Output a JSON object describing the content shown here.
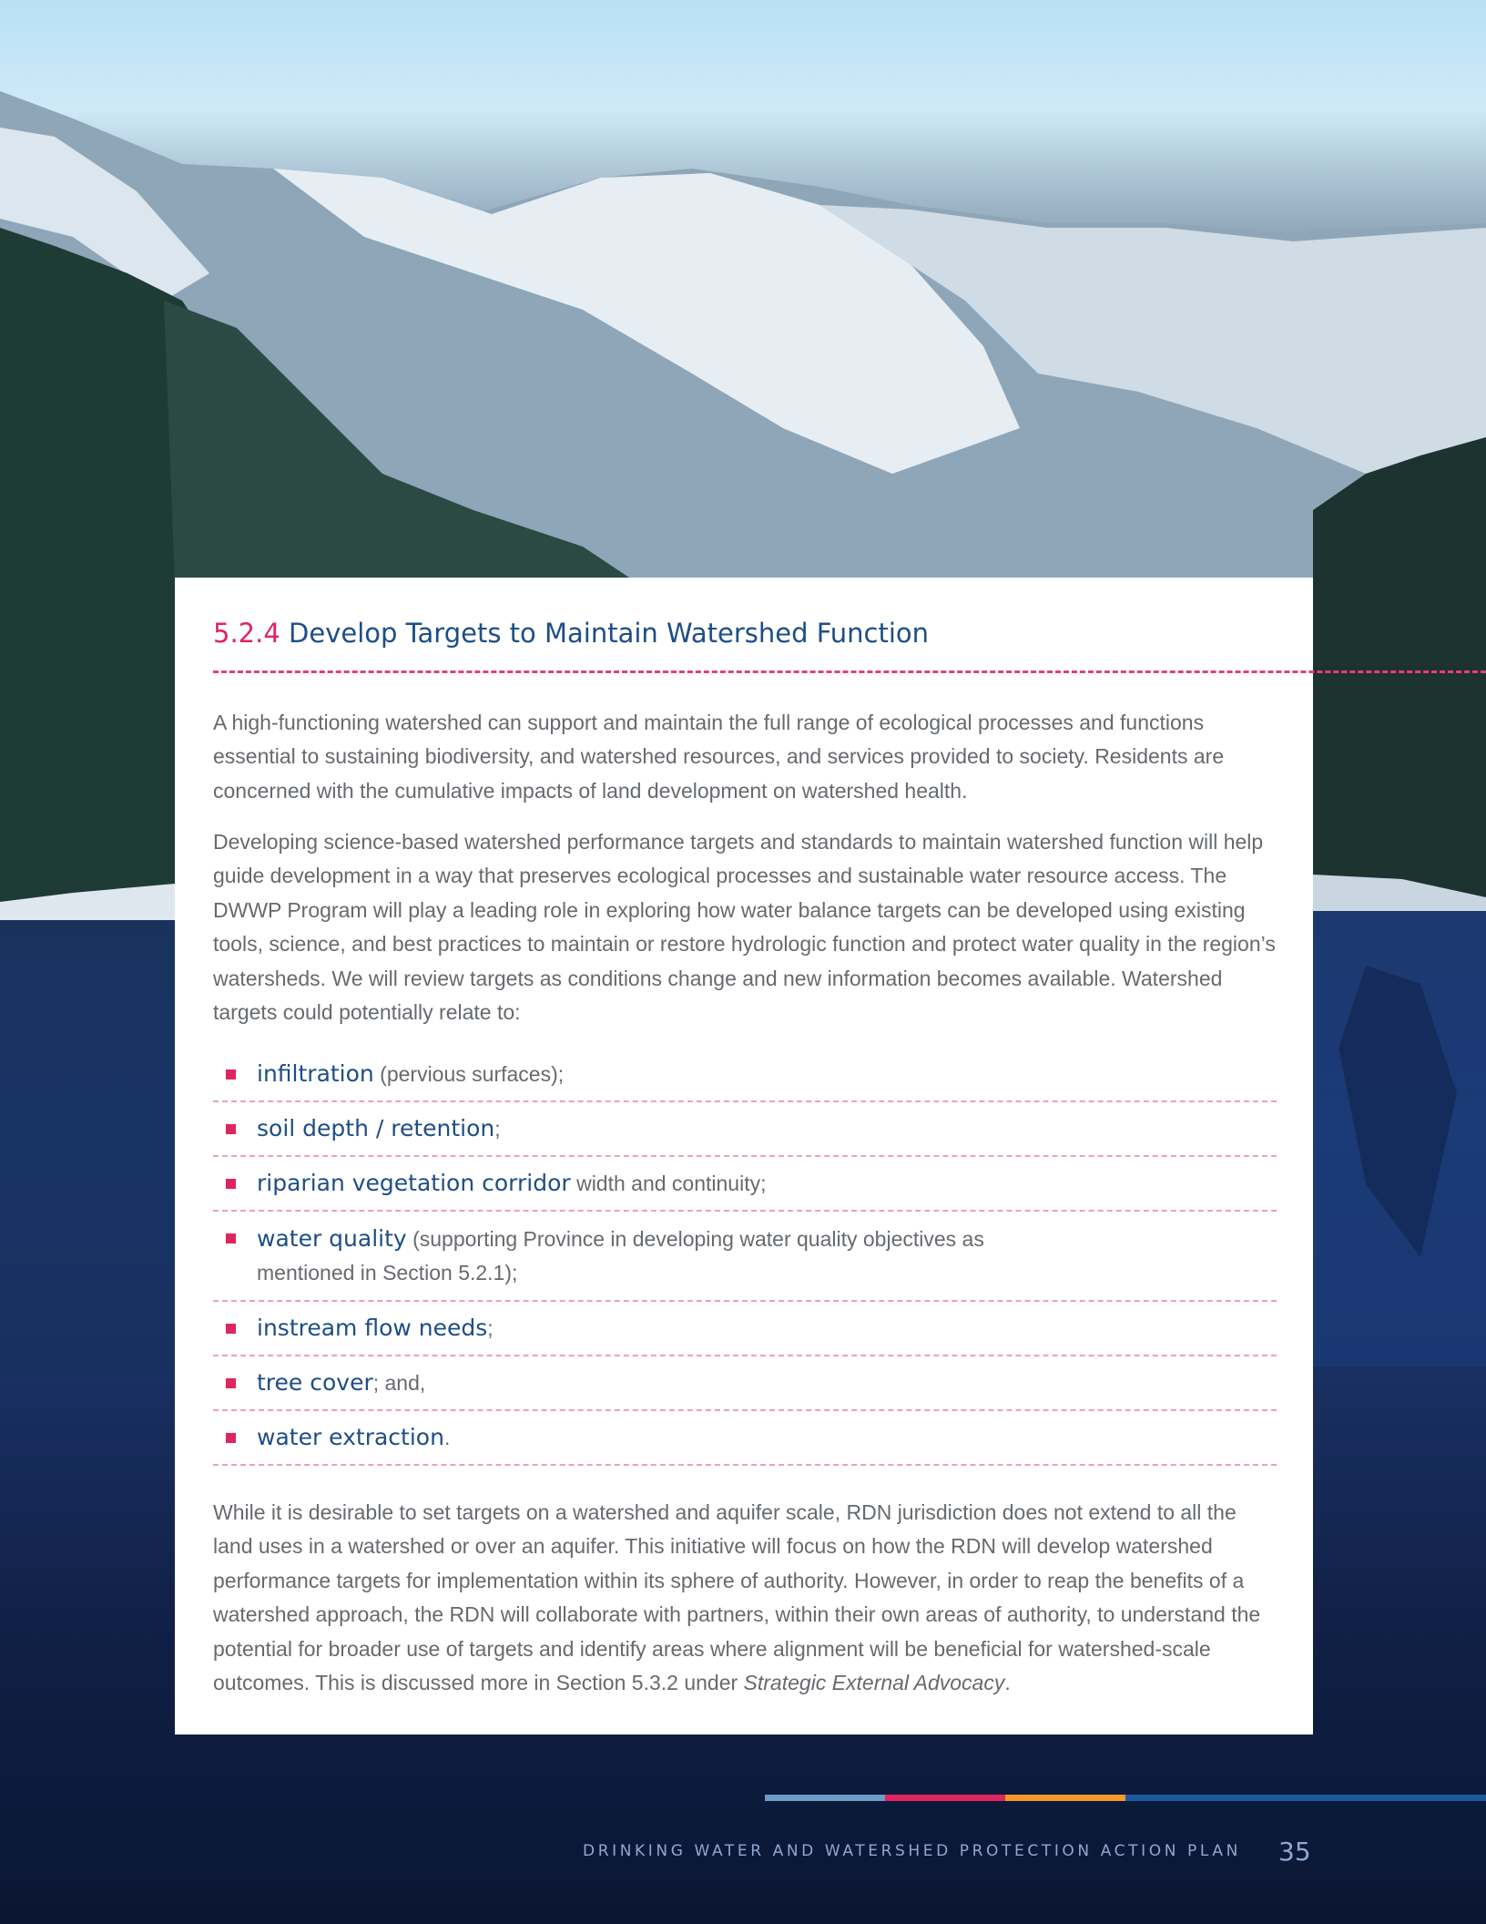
{
  "section": {
    "number": "5.2.4",
    "title": "Develop Targets to Maintain Watershed Function"
  },
  "paragraphs": {
    "p1": "A high-functioning watershed can support and maintain the full range of ecological processes and functions essential to sustaining biodiversity, and watershed resources, and services provided to society. Residents are concerned with the cumulative impacts of land development on watershed health.",
    "p2": "Developing science-based watershed performance targets and standards to maintain watershed function will help guide development in a way that preserves ecological processes and sustainable water resource access. The DWWP Program will play a leading role in exploring how water balance targets can be developed using existing tools, science, and best practices to maintain or restore hydrologic function and protect water quality in the region’s watersheds. We will review targets as conditions change and new information becomes available. Watershed targets could potentially relate to:",
    "p3_main": "While it is desirable to set targets on a watershed and aquifer scale, RDN jurisdiction does not extend to all the land uses in a watershed or over an aquifer. This initiative will focus on how the RDN will develop watershed performance targets for implementation within its sphere of authority. However, in order to reap the benefits of a watershed approach, the RDN will collaborate with partners, within their own areas of authority, to understand the potential for broader use of targets and identify areas where alignment will be beneficial for watershed-scale outcomes. This is discussed more in Section 5.3.2 under ",
    "p3_italic": "Strategic External Advocacy",
    "p3_end": "."
  },
  "targets": [
    {
      "term": "infiltration",
      "rest": " (pervious surfaces);"
    },
    {
      "term": "soil depth / retention",
      "rest": ";"
    },
    {
      "term": "riparian vegetation corridor",
      "rest": " width and continuity;"
    },
    {
      "term": "water quality",
      "rest": " (supporting Province in developing water quality objectives as",
      "rest2": "mentioned in Section 5.2.1);"
    },
    {
      "term": "instream flow needs",
      "rest": ";"
    },
    {
      "term": "tree cover",
      "rest": "; and,"
    },
    {
      "term": "water extraction",
      "rest": "."
    }
  ],
  "footer": {
    "title": "DRINKING WATER AND WATERSHED PROTECTION ACTION PLAN",
    "page_number": "35"
  },
  "colors": {
    "accent_pink": "#e0245e",
    "heading_blue": "#1d4e86",
    "bar_light_blue": "#6f99c6",
    "bar_pink": "#e0245e",
    "bar_orange": "#f39a2b",
    "bar_dark_blue": "#1c5aa0"
  }
}
